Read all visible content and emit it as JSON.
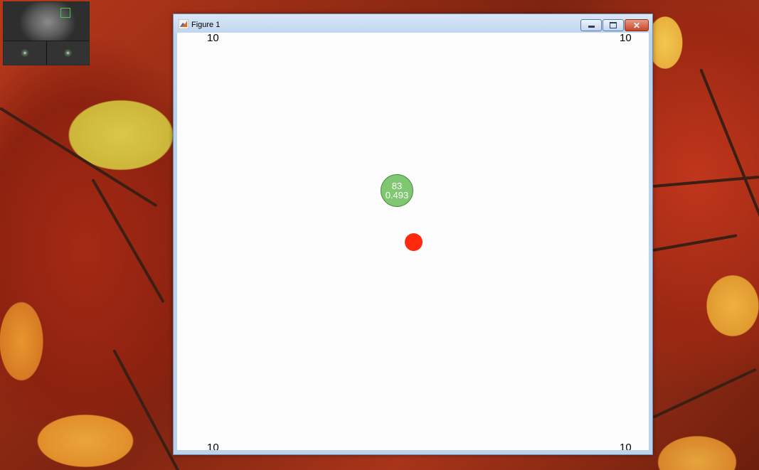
{
  "window": {
    "title": "Figure 1",
    "icon": "matlab-icon",
    "close_glyph": "✕"
  },
  "webcam": {
    "icon": "webcam-preview"
  },
  "canvas": {
    "corner_labels": {
      "top_left": "10",
      "top_right": "10",
      "bottom_left": "10",
      "bottom_right": "10"
    },
    "target": {
      "line1": "83",
      "line2": "0.493",
      "color": "#7fc771"
    },
    "gaze_dot": {
      "color": "#ff2a0e"
    }
  }
}
